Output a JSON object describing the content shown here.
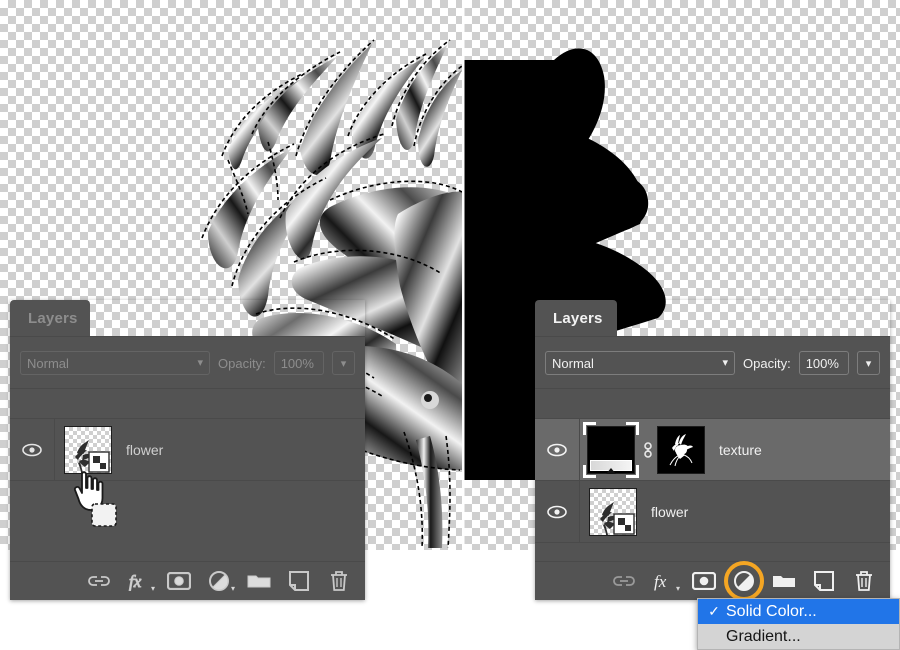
{
  "app": "Adobe Photoshop layers panel",
  "canvas": {
    "artwork_description": "chrome metallic flower with marching-ants selection, right half black silhouette",
    "background": "transparency-checkerboard"
  },
  "panel_left": {
    "tab_label": "Layers",
    "state": "inactive",
    "blend_mode": "Normal",
    "blend_caret": "chevron-down",
    "opacity_label": "Opacity:",
    "opacity_value": "100%",
    "opacity_caret": "chevron-down",
    "layers": [
      {
        "name": "flower",
        "visible": true,
        "selected": false,
        "thumb": "checker-flower"
      }
    ],
    "toolbar": [
      {
        "name": "link-layers",
        "icon": "chain-link-icon",
        "label": "Link layers"
      },
      {
        "name": "layer-style",
        "icon": "fx-icon",
        "label": "Add a layer style"
      },
      {
        "name": "layer-mask",
        "icon": "mask-icon",
        "label": "Add layer mask"
      },
      {
        "name": "adjustment-layer",
        "icon": "adjustment-circle-icon",
        "label": "Create new fill or adjustment layer"
      },
      {
        "name": "new-group",
        "icon": "folder-icon",
        "label": "Create a new group"
      },
      {
        "name": "new-layer",
        "icon": "new-layer-icon",
        "label": "Create a new layer"
      },
      {
        "name": "delete-layer",
        "icon": "trash-icon",
        "label": "Delete layer"
      }
    ]
  },
  "panel_right": {
    "tab_label": "Layers",
    "state": "active",
    "blend_mode": "Normal",
    "blend_caret": "chevron-down",
    "opacity_label": "Opacity:",
    "opacity_value": "100%",
    "opacity_caret": "chevron-down",
    "layers": [
      {
        "name": "texture",
        "visible": true,
        "selected": true,
        "thumb": "gradient-adjustment",
        "mask_thumb": "black-with-white-flower",
        "linked": true
      },
      {
        "name": "flower",
        "visible": true,
        "selected": false,
        "thumb": "checker-flower"
      }
    ],
    "toolbar": [
      {
        "name": "link-layers",
        "icon": "chain-link-icon",
        "label": "Link layers"
      },
      {
        "name": "layer-style",
        "icon": "fx-icon",
        "label": "Add a layer style"
      },
      {
        "name": "layer-mask",
        "icon": "mask-icon",
        "label": "Add layer mask"
      },
      {
        "name": "adjustment-layer",
        "icon": "adjustment-circle-icon",
        "label": "Create new fill or adjustment layer"
      },
      {
        "name": "new-group",
        "icon": "folder-icon",
        "label": "Create a new group"
      },
      {
        "name": "new-layer",
        "icon": "new-layer-icon",
        "label": "Create a new layer"
      },
      {
        "name": "delete-layer",
        "icon": "trash-icon",
        "label": "Delete layer"
      }
    ],
    "highlight_ring_color": "#f5a623",
    "highlighted_tool": "adjustment-layer"
  },
  "context_menu": {
    "items": [
      {
        "label": "Solid Color...",
        "checked": true,
        "highlighted": true,
        "check_glyph": "✓"
      },
      {
        "label": "Gradient...",
        "checked": false,
        "highlighted": false,
        "check_glyph": ""
      }
    ]
  },
  "cursor": {
    "type": "hand-drag-cursor",
    "badge": "dashed-square"
  },
  "colors": {
    "panel_bg": "#535353",
    "row_selected": "#6a6a6a",
    "menu_bg": "#d4d4d4",
    "menu_highlight": "#2175e8",
    "accent_ring": "#f5a623"
  }
}
